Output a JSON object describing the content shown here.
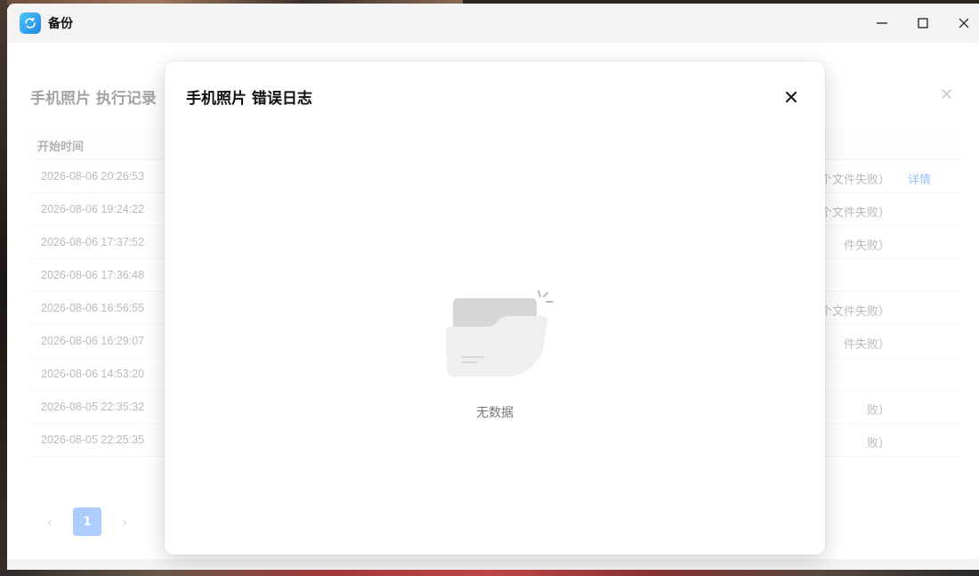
{
  "window": {
    "title": "备份",
    "controls": {
      "minimize": "minimize-icon",
      "maximize": "maximize-icon",
      "close": "close-icon"
    }
  },
  "records_panel": {
    "title": "手机照片 执行记录",
    "column_start_time": "开始时间",
    "rows": [
      {
        "time": "2026-08-06 20:26:53",
        "status": "个文件失败）",
        "detail": "详情"
      },
      {
        "time": "2026-08-06 19:24:22",
        "status": "个文件失败）",
        "detail": ""
      },
      {
        "time": "2026-08-06 17:37:52",
        "status": "件失败）",
        "detail": ""
      },
      {
        "time": "2026-08-06 17:36:48",
        "status": "",
        "detail": ""
      },
      {
        "time": "2026-08-06 16:56:55",
        "status": "个文件失败）",
        "detail": ""
      },
      {
        "time": "2026-08-06 16:29:07",
        "status": "件失败）",
        "detail": ""
      },
      {
        "time": "2026-08-06 14:53:20",
        "status": "",
        "detail": ""
      },
      {
        "time": "2026-08-05 22:35:32",
        "status": "败）",
        "detail": ""
      },
      {
        "time": "2026-08-05 22:25:35",
        "status": "败）",
        "detail": ""
      }
    ],
    "pagination": {
      "prev": "‹",
      "current_page": "1",
      "next": "›"
    }
  },
  "modal": {
    "title": "手机照片 错误日志",
    "empty_text": "无数据"
  },
  "colors": {
    "accent": "#1677ff",
    "page_button": "#4a90ff"
  }
}
